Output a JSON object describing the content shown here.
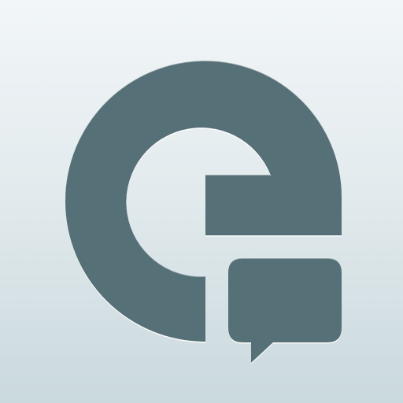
{
  "app_icon": {
    "glyph": "e-letter-icon",
    "badge": "speech-bubble-icon",
    "colors": {
      "background_top": "#f2f6f8",
      "background_bottom": "#cad9dd",
      "glyph_fill": "#556f77",
      "highlight": "#ffffff",
      "shadow": "#3c5057"
    }
  }
}
